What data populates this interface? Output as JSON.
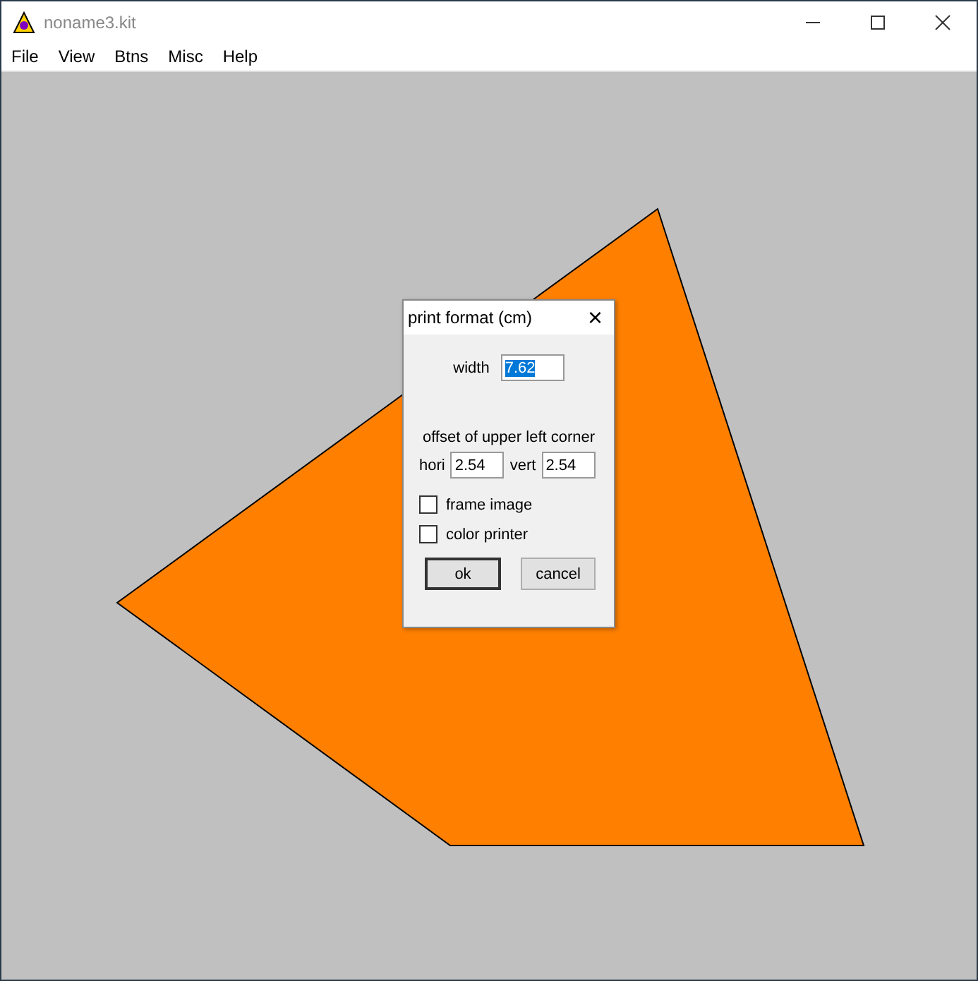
{
  "window": {
    "title": "noname3.kit"
  },
  "menu": [
    {
      "label": "File"
    },
    {
      "label": "View"
    },
    {
      "label": "Btns"
    },
    {
      "label": "Misc"
    },
    {
      "label": "Help"
    }
  ],
  "dialog": {
    "title": "print format (cm)",
    "close": "×",
    "width_field": {
      "label": "width",
      "value": "7.62",
      "selected": true
    },
    "offset_heading": "offset of upper left corner",
    "offset_fields": [
      {
        "label": "hori",
        "value": "2.54"
      },
      {
        "label": "vert",
        "value": "2.54"
      }
    ],
    "checkboxes": [
      {
        "label": "frame image",
        "checked": false
      },
      {
        "label": "color printer",
        "checked": false
      }
    ],
    "buttons": [
      {
        "label": "ok",
        "default": true
      },
      {
        "label": "cancel",
        "default": false
      }
    ]
  }
}
